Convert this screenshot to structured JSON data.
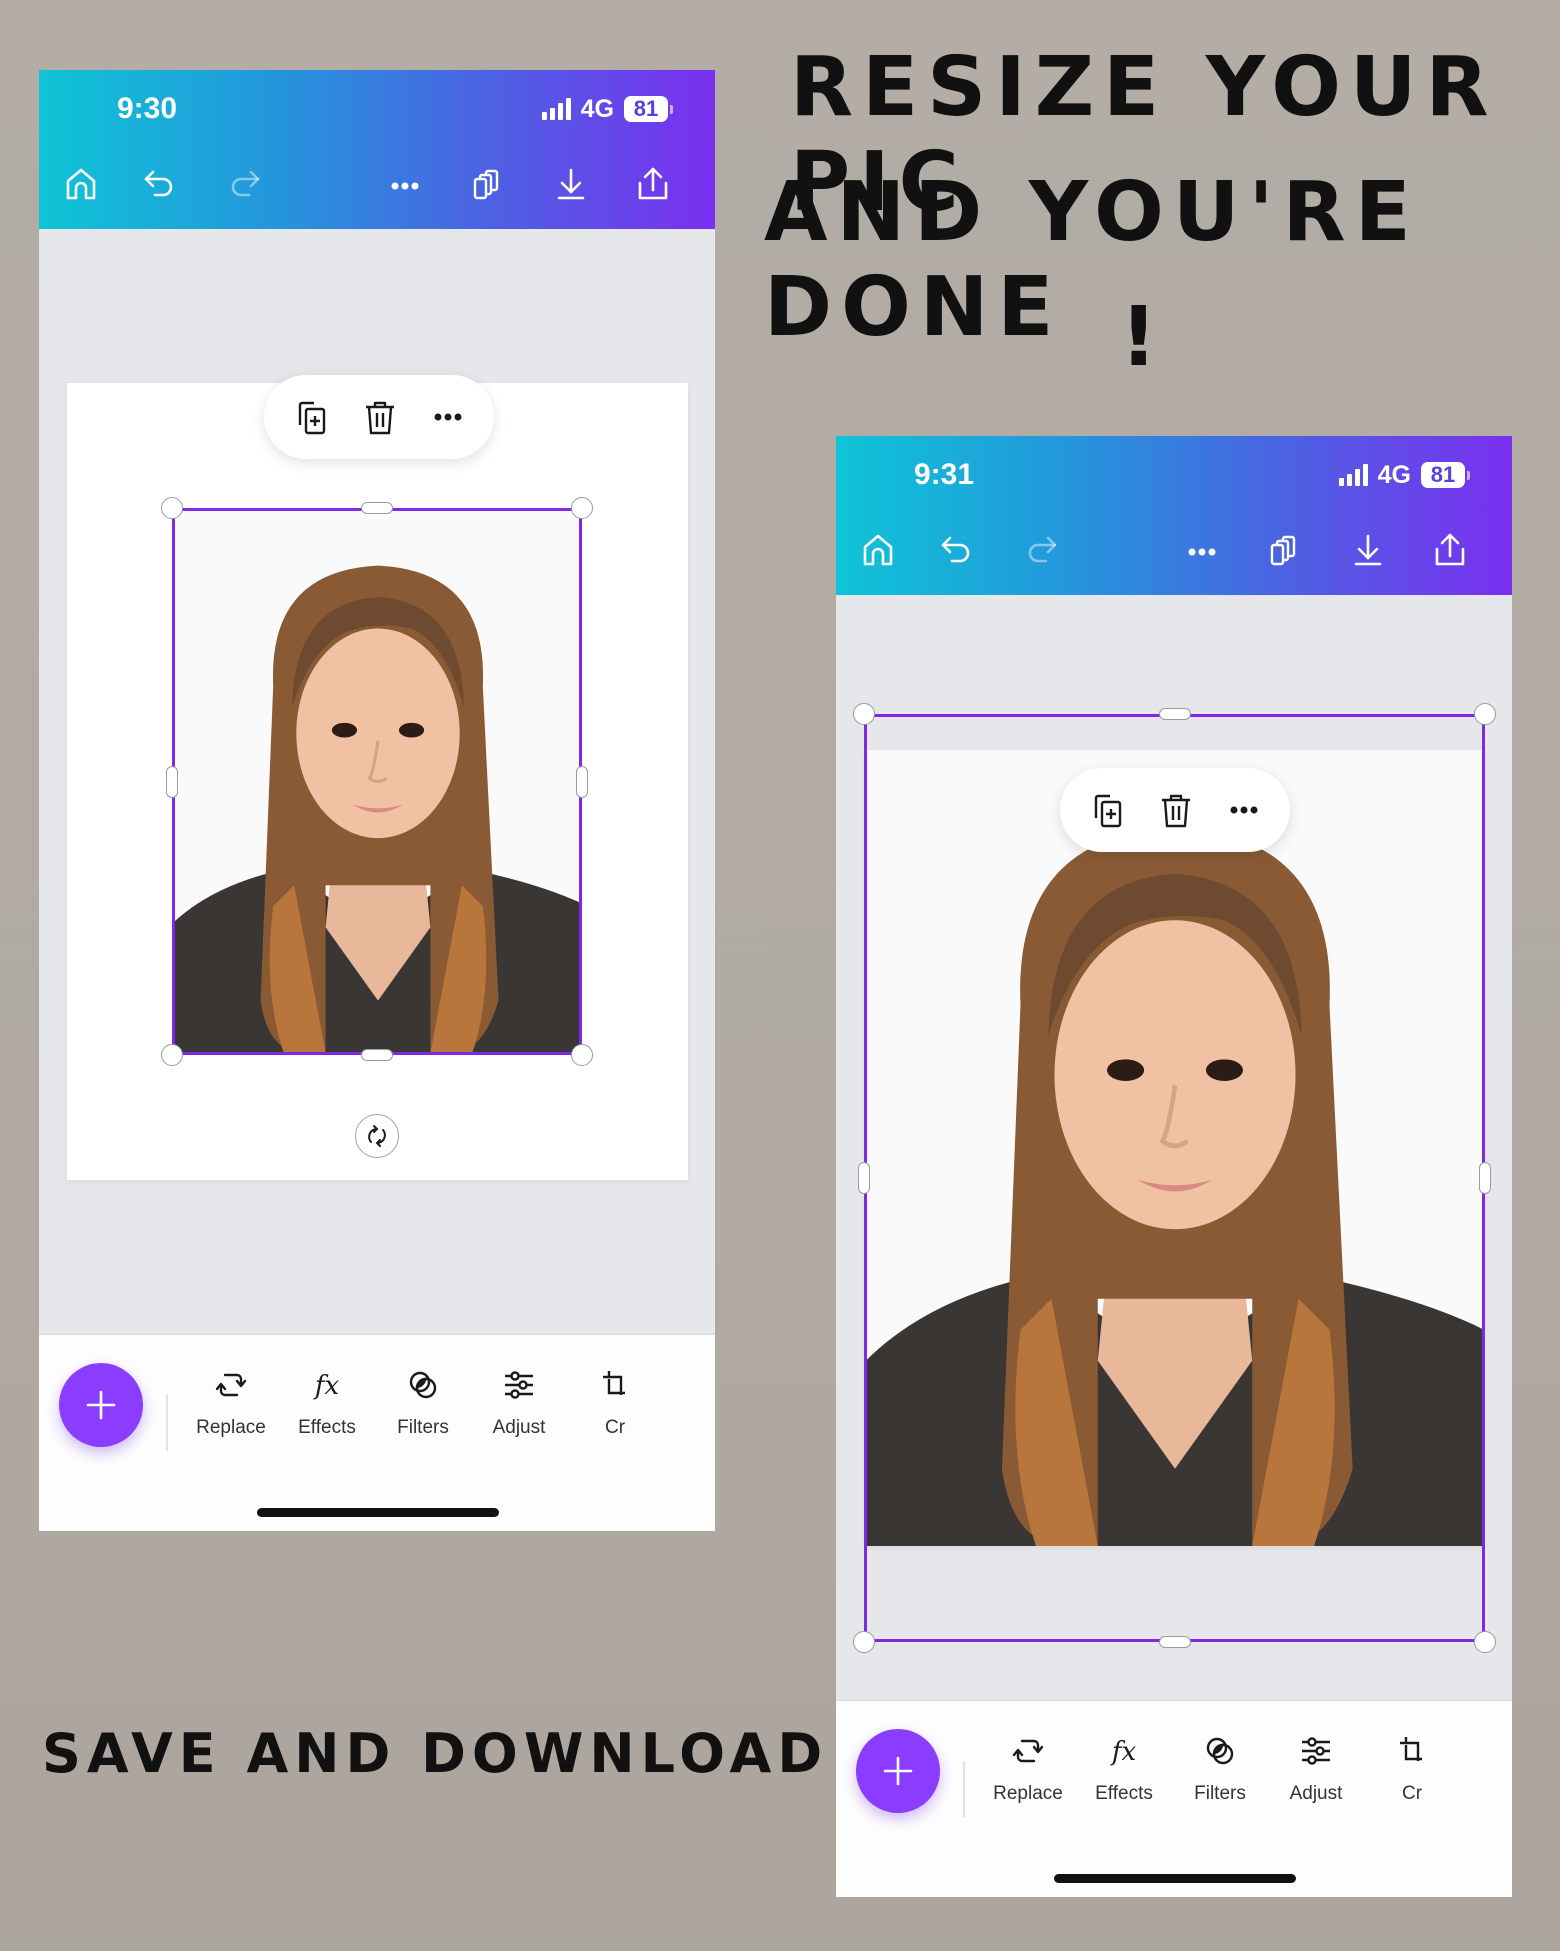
{
  "headline": {
    "line1": "RESiZE YOUR PiC",
    "line2": "AND YOU'RE DONE",
    "line3": "!"
  },
  "caption": "SAVE AND DOWNLOAD :-)",
  "colors": {
    "header_gradient_start": "#0fc4d6",
    "header_gradient_end": "#7b2ff0",
    "selection": "#7d2ae8",
    "fab": "#8b3dff"
  },
  "phones": [
    {
      "status": {
        "time": "9:30",
        "network": "4G",
        "battery": "81"
      },
      "toolbar": [
        "home-icon",
        "undo-icon",
        "redo-icon",
        "more-icon",
        "pages-icon",
        "download-icon",
        "share-icon"
      ],
      "floating_toolbar": [
        "duplicate-icon",
        "delete-icon",
        "more-icon"
      ],
      "bottom_tools": [
        {
          "label": "Replace",
          "icon": "replace-icon"
        },
        {
          "label": "Effects",
          "icon": "effects-icon"
        },
        {
          "label": "Filters",
          "icon": "filters-icon"
        },
        {
          "label": "Adjust",
          "icon": "adjust-icon"
        },
        {
          "label": "Cr",
          "icon": "crop-icon"
        }
      ]
    },
    {
      "status": {
        "time": "9:31",
        "network": "4G",
        "battery": "81"
      },
      "toolbar": [
        "home-icon",
        "undo-icon",
        "redo-icon",
        "more-icon",
        "pages-icon",
        "download-icon",
        "share-icon"
      ],
      "floating_toolbar": [
        "duplicate-icon",
        "delete-icon",
        "more-icon"
      ],
      "bottom_tools": [
        {
          "label": "Replace",
          "icon": "replace-icon"
        },
        {
          "label": "Effects",
          "icon": "effects-icon"
        },
        {
          "label": "Filters",
          "icon": "filters-icon"
        },
        {
          "label": "Adjust",
          "icon": "adjust-icon"
        },
        {
          "label": "Cr",
          "icon": "crop-icon"
        }
      ]
    }
  ]
}
